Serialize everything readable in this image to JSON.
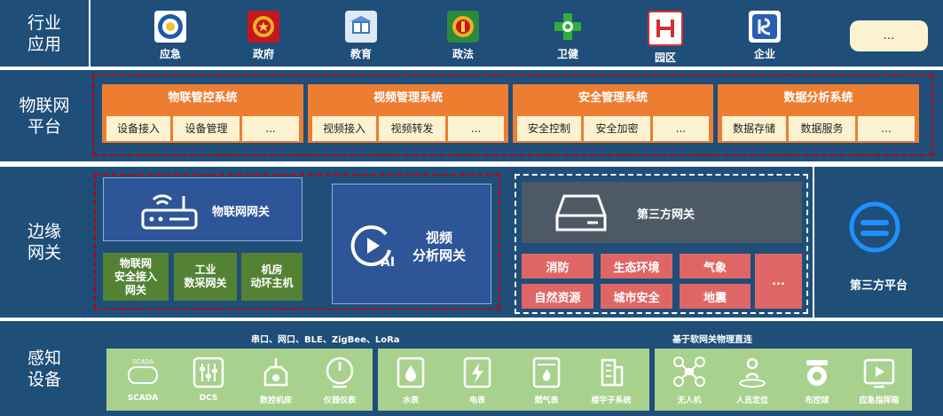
{
  "industry": {
    "label": "行业\n应用",
    "sectors": [
      {
        "name": "应急",
        "icon": "emergency-emblem-icon",
        "color": "#1f5aa6"
      },
      {
        "name": "政府",
        "icon": "national-emblem-icon",
        "color": "#c8161d"
      },
      {
        "name": "教育",
        "icon": "education-book-icon",
        "color": "#3a7bbf"
      },
      {
        "name": "政法",
        "icon": "law-emblem-icon",
        "color": "#2b8a3e"
      },
      {
        "name": "卫健",
        "icon": "health-cross-icon",
        "color": "#2eae3a"
      },
      {
        "name": "园区",
        "icon": "park-logo-icon",
        "color": "#d32f2f"
      },
      {
        "name": "企业",
        "icon": "enterprise-logo-icon",
        "color": "#2a5fb0"
      }
    ],
    "more": "..."
  },
  "iot_platform": {
    "label": "物联网\n平台",
    "systems": [
      {
        "title": "物联管控系统",
        "items": [
          "设备接入",
          "设备管理",
          "..."
        ]
      },
      {
        "title": "视频管理系统",
        "items": [
          "视频接入",
          "视频转发",
          "..."
        ]
      },
      {
        "title": "安全管理系统",
        "items": [
          "安全控制",
          "安全加密",
          "..."
        ]
      },
      {
        "title": "数据分析系统",
        "items": [
          "数据存储",
          "数据服务",
          "..."
        ]
      }
    ]
  },
  "edge": {
    "label": "边缘\n网关",
    "iot_gateway": "物联网网关",
    "sub_gateways": [
      "物联网\n安全接入\n网关",
      "工业\n数采网关",
      "机房\n动环主机"
    ],
    "video_gateway": "视频\n分析网关",
    "ai_text": "AI",
    "third_gateway": "第三方网关",
    "third_items": [
      "消防",
      "生态环境",
      "气象",
      "自然资源",
      "城市安全",
      "地震"
    ],
    "third_more": "...",
    "third_platform": "第三方平台",
    "colors": {
      "dark": "#2e5597",
      "blue": "#3b64a8",
      "green": "#548235",
      "red": "#e06666",
      "gray": "#4d5a66"
    }
  },
  "sensing": {
    "label": "感知\n设备",
    "left_note": "串口、网口、BLE、ZigBee、LoRa",
    "right_note": "基于软网关物理直连",
    "group1": [
      {
        "name": "SCADA",
        "icon": "scada-icon",
        "caption": "SCADA"
      },
      {
        "name": "DCS",
        "icon": "dcs-sliders-icon"
      },
      {
        "name": "数控机床",
        "icon": "cnc-machine-icon"
      },
      {
        "name": "仪器仪表",
        "icon": "gauge-icon"
      }
    ],
    "group2": [
      {
        "name": "水表",
        "icon": "water-meter-icon"
      },
      {
        "name": "电表",
        "icon": "electric-meter-icon"
      },
      {
        "name": "燃气表",
        "icon": "gas-meter-icon"
      },
      {
        "name": "楼宇子系统",
        "icon": "building-icon"
      }
    ],
    "group3": [
      {
        "name": "无人机",
        "icon": "drone-icon"
      },
      {
        "name": "人员定位",
        "icon": "person-location-icon"
      },
      {
        "name": "布控球",
        "icon": "dome-camera-icon"
      },
      {
        "name": "应急指挥箱",
        "icon": "command-box-icon"
      }
    ]
  }
}
